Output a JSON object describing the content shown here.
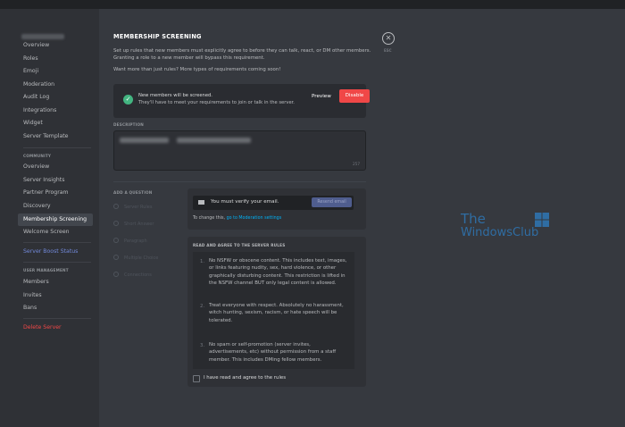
{
  "sidebar": {
    "server_items": [
      "Overview",
      "Roles",
      "Emoji",
      "Moderation",
      "Audit Log",
      "Integrations",
      "Widget",
      "Server Template"
    ],
    "community_header": "COMMUNITY",
    "community_items": [
      "Overview",
      "Server Insights",
      "Partner Program",
      "Discovery",
      "Membership Screening",
      "Welcome Screen"
    ],
    "boost": "Server Boost Status",
    "user_header": "USER MANAGEMENT",
    "user_items": [
      "Members",
      "Invites",
      "Bans"
    ],
    "delete": "Delete Server"
  },
  "main": {
    "title": "MEMBERSHIP SCREENING",
    "intro_line1": "Set up rules that new members must explicitly agree to before they can talk, react, or DM other members.",
    "intro_line2": "Granting a role to a new member will bypass this requirement.",
    "more": "Want more than just rules? More types of requirements coming soon!",
    "notice": {
      "line1": "New members will be screened.",
      "line2": "They'll have to meet your requirements to join or talk in the server.",
      "preview": "Preview",
      "disable": "Disable"
    },
    "description_label": "DESCRIPTION",
    "description_count": "257",
    "add_question_label": "ADD A QUESTION",
    "question_types": [
      "Server Rules",
      "Short Answer",
      "Paragraph",
      "Multiple Choice",
      "Connections"
    ],
    "verify": {
      "text": "You must verify your email.",
      "resend": "Resend email",
      "change_prefix": "To change this, ",
      "change_link": "go to Moderation settings"
    },
    "rules": {
      "label": "READ AND AGREE TO THE SERVER RULES",
      "items": [
        {
          "n": "1.",
          "text": "No NSFW or obscene content. This includes text, images, or links featuring nudity, sex, hard violence, or other graphically disturbing content. This restriction is lifted in the NSFW channel BUT only legal content is allowed."
        },
        {
          "n": "2.",
          "text": "Treat everyone with respect. Absolutely no harassment, witch hunting, sexism, racism, or hate speech will be tolerated."
        },
        {
          "n": "3.",
          "text": "No spam or self-promotion (server invites, advertisements, etc) without permission from a staff member. This includes DMing fellow members."
        }
      ],
      "agree": "I have read and agree to the rules"
    },
    "esc": "ESC"
  },
  "watermark": {
    "line1": "The",
    "line2": "WindowsClub"
  },
  "colors": {
    "accent": "#7289da",
    "danger": "#f04747",
    "success": "#43b581",
    "link": "#00b0f4"
  }
}
